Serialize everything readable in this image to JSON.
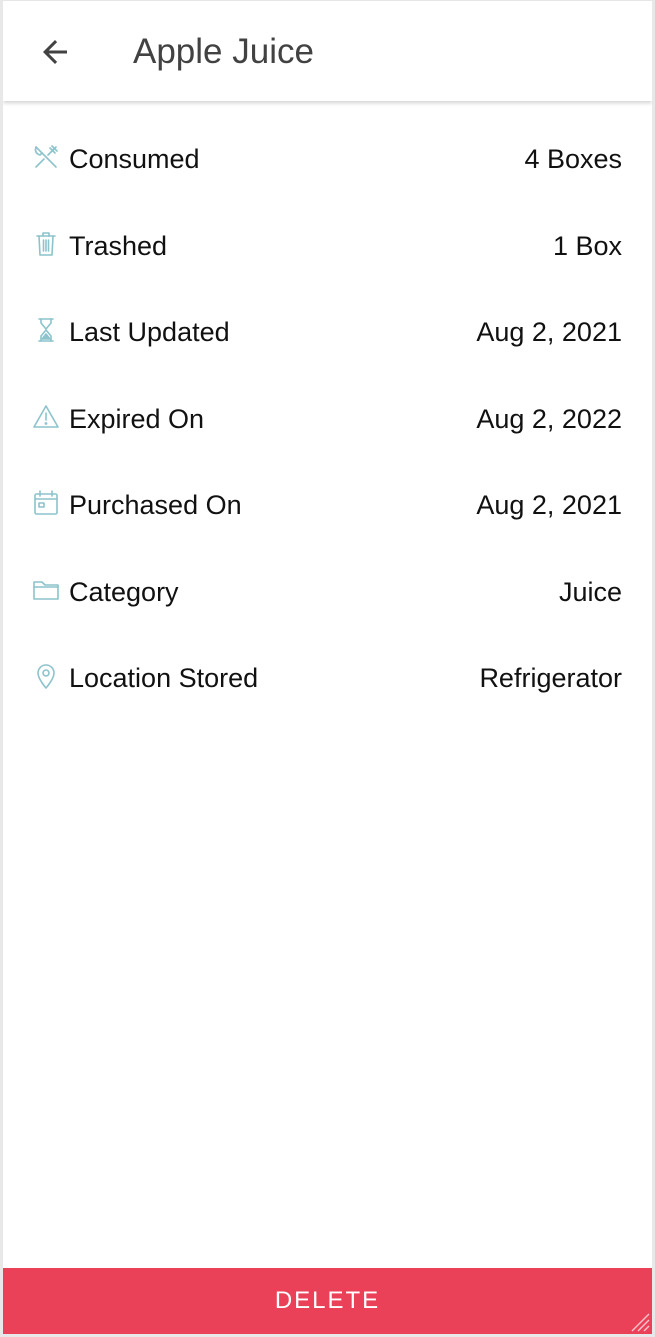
{
  "header": {
    "back_icon": "arrow-left-icon",
    "title": "Apple Juice"
  },
  "details": [
    {
      "icon": "utensils-icon",
      "label": "Consumed",
      "value": "4 Boxes"
    },
    {
      "icon": "trash-icon",
      "label": "Trashed",
      "value": "1 Box"
    },
    {
      "icon": "hourglass-icon",
      "label": "Last Updated",
      "value": "Aug 2, 2021"
    },
    {
      "icon": "warning-icon",
      "label": "Expired On",
      "value": "Aug 2, 2022"
    },
    {
      "icon": "calendar-icon",
      "label": "Purchased On",
      "value": "Aug 2, 2021"
    },
    {
      "icon": "folder-icon",
      "label": "Category",
      "value": "Juice"
    },
    {
      "icon": "location-pin-icon",
      "label": "Location Stored",
      "value": "Refrigerator"
    }
  ],
  "footer": {
    "delete_label": "DELETE"
  },
  "colors": {
    "icon_accent": "#8cc3cc",
    "delete_bg": "#ea4159",
    "title_text": "#424242"
  }
}
